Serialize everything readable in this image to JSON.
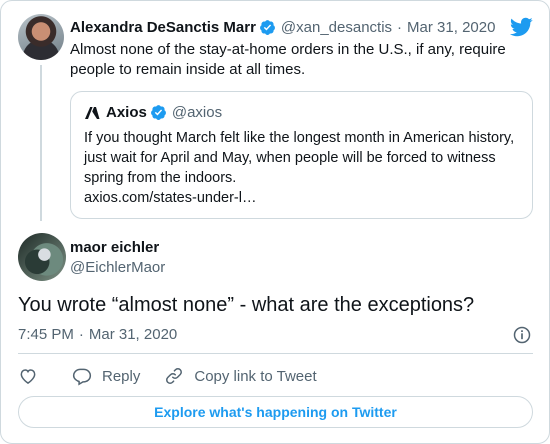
{
  "colors": {
    "brand_blue": "#1d9bf0",
    "muted": "#536471",
    "border": "#cfd9de",
    "text": "#0f1419"
  },
  "parent_tweet": {
    "author_name": "Alexandra DeSanctis Marr",
    "handle": "@xan_desanctis",
    "separator": "·",
    "date": "Mar 31, 2020",
    "text": "Almost none of the stay-at-home orders in the U.S., if any, require people to remain inside at all times.",
    "verified_icon": "verified-badge-icon",
    "logo_icon": "twitter-bird-icon"
  },
  "quoted_tweet": {
    "author_name": "Axios",
    "handle": "@axios",
    "text": "If you thought March felt like the longest month in American history, just wait for April and May, when people will be forced to witness spring from the indoors.",
    "link": "axios.com/states-under-l…",
    "logo_icon": "axios-logo-icon"
  },
  "reply_tweet": {
    "author_name": "maor eichler",
    "handle": "@EichlerMaor",
    "text": "You wrote “almost none” - what are the exceptions?",
    "time": "7:45 PM",
    "separator": "·",
    "date": "Mar 31, 2020",
    "info_icon": "info-icon"
  },
  "actions": {
    "like_icon": "heart-icon",
    "reply_label": "Reply",
    "reply_icon": "reply-bubble-icon",
    "copy_link_label": "Copy link to Tweet",
    "copy_link_icon": "link-icon"
  },
  "explore_button": {
    "label": "Explore what's happening on Twitter"
  }
}
